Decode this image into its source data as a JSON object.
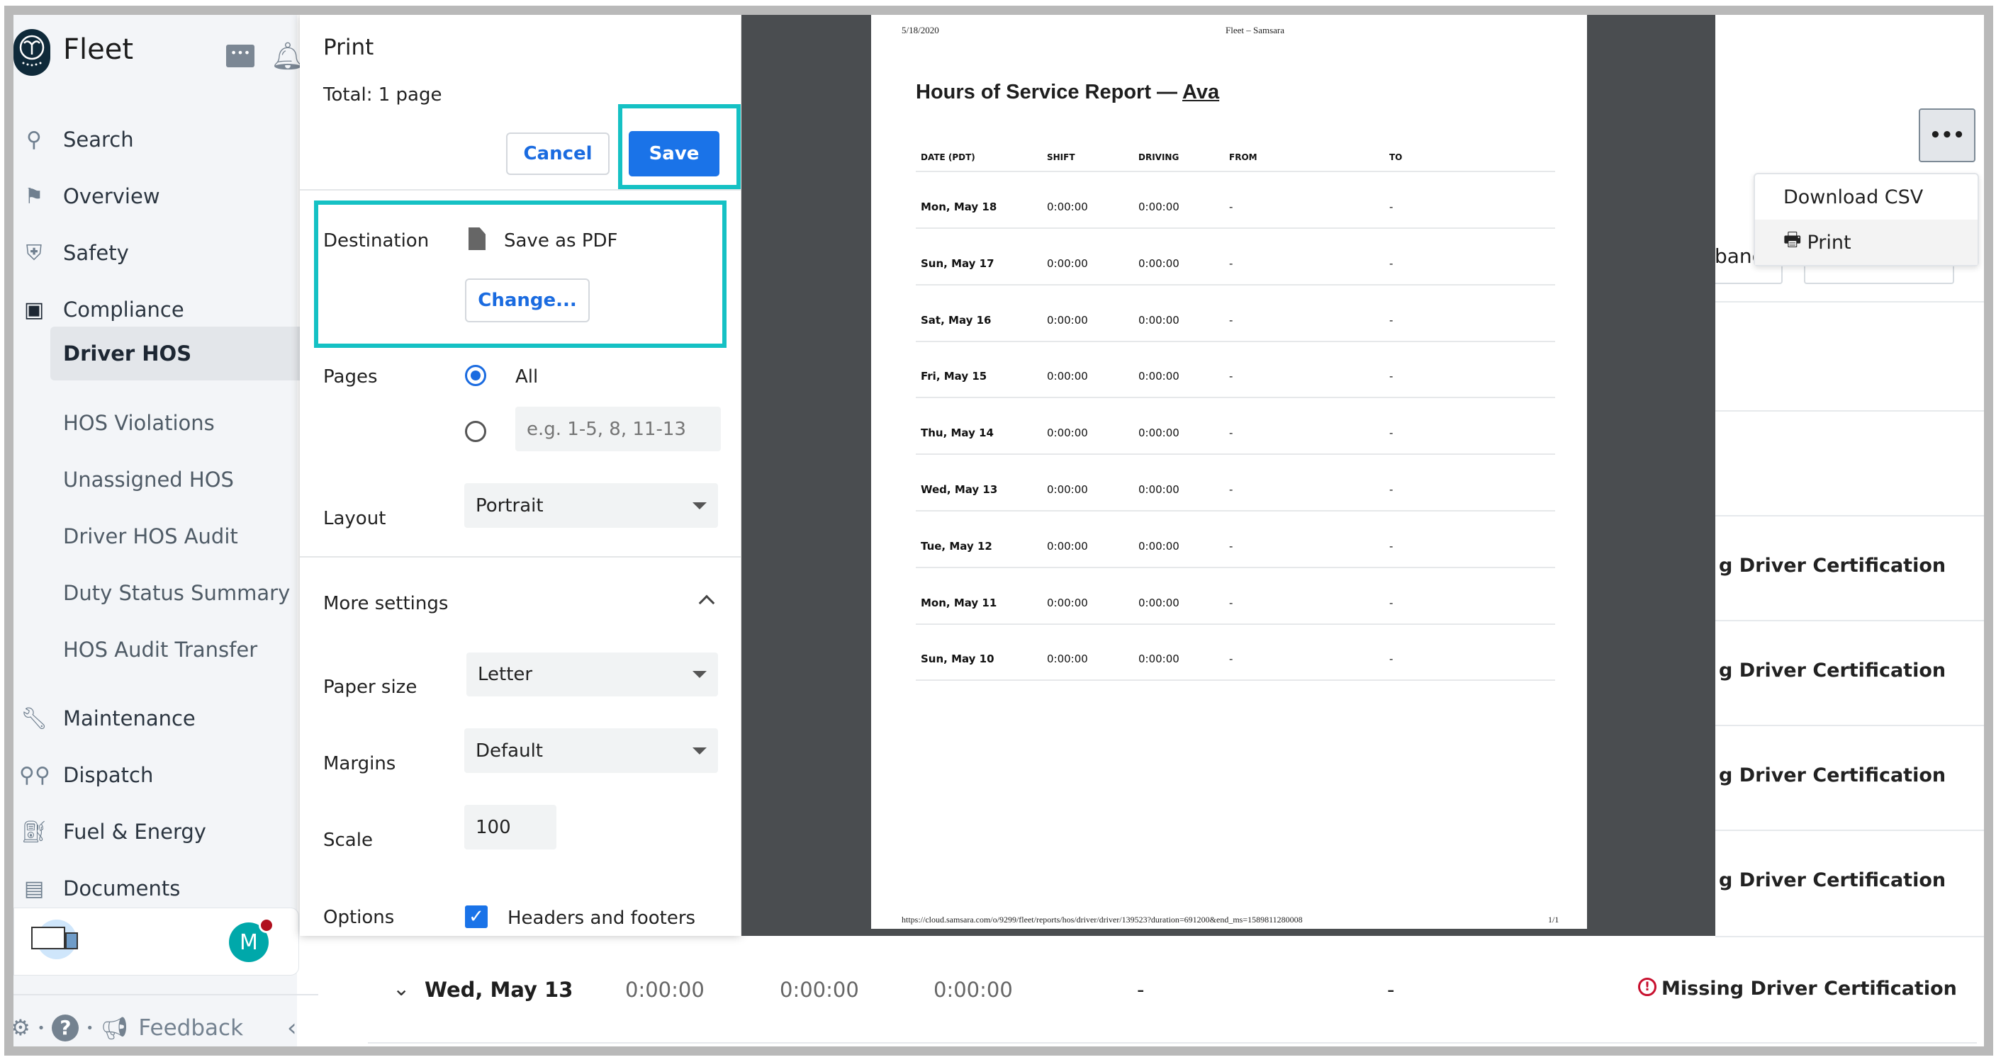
{
  "app": {
    "title": "Fleet"
  },
  "sidebar": {
    "items": [
      {
        "label": "Search",
        "icon": "search-icon"
      },
      {
        "label": "Overview",
        "icon": "map-pin-icon"
      },
      {
        "label": "Safety",
        "icon": "shield-icon"
      },
      {
        "label": "Compliance",
        "icon": "clipboard-icon"
      },
      {
        "label": "Driver HOS",
        "active": true
      },
      {
        "label": "HOS Violations"
      },
      {
        "label": "Unassigned HOS"
      },
      {
        "label": "Driver HOS Audit"
      },
      {
        "label": "Duty Status Summary"
      },
      {
        "label": "HOS Audit Transfer"
      },
      {
        "label": "Maintenance",
        "icon": "wrench-icon"
      },
      {
        "label": "Dispatch",
        "icon": "route-icon"
      },
      {
        "label": "Fuel & Energy",
        "icon": "fuel-icon"
      },
      {
        "label": "Documents",
        "icon": "document-icon"
      }
    ],
    "avatar_initial": "M",
    "feedback": "Feedback"
  },
  "print": {
    "title": "Print",
    "total": "Total: 1 page",
    "cancel": "Cancel",
    "save": "Save",
    "destination_label": "Destination",
    "destination_value": "Save as PDF",
    "change": "Change...",
    "pages_label": "Pages",
    "pages_all": "All",
    "pages_placeholder": "e.g. 1-5, 8, 11-13",
    "layout_label": "Layout",
    "layout_value": "Portrait",
    "more_settings": "More settings",
    "paper_label": "Paper size",
    "paper_value": "Letter",
    "margins_label": "Margins",
    "margins_value": "Default",
    "scale_label": "Scale",
    "scale_value": "100",
    "options_label": "Options",
    "headers_footers": "Headers and footers",
    "headers_footers_checked": true,
    "highlight_color": "#15c1c4"
  },
  "preview": {
    "header_date": "5/18/2020",
    "header_title": "Fleet – Samsara",
    "title": "Hours of Service Report — ",
    "driver": "Ava",
    "columns": [
      "DATE (PDT)",
      "SHIFT",
      "DRIVING",
      "FROM",
      "TO"
    ],
    "rows": [
      [
        "Mon, May 18",
        "0:00:00",
        "0:00:00",
        "-",
        "-"
      ],
      [
        "Sun, May 17",
        "0:00:00",
        "0:00:00",
        "-",
        "-"
      ],
      [
        "Sat, May 16",
        "0:00:00",
        "0:00:00",
        "-",
        "-"
      ],
      [
        "Fri, May 15",
        "0:00:00",
        "0:00:00",
        "-",
        "-"
      ],
      [
        "Thu, May 14",
        "0:00:00",
        "0:00:00",
        "-",
        "-"
      ],
      [
        "Wed, May 13",
        "0:00:00",
        "0:00:00",
        "-",
        "-"
      ],
      [
        "Tue, May 12",
        "0:00:00",
        "0:00:00",
        "-",
        "-"
      ],
      [
        "Mon, May 11",
        "0:00:00",
        "0:00:00",
        "-",
        "-"
      ],
      [
        "Sun, May 10",
        "0:00:00",
        "0:00:00",
        "-",
        "-"
      ]
    ],
    "footer_url": "https://cloud.samsara.com/o/9299/fleet/reports/hos/driver/driver/139523?duration=691200&end_ms=1589811280008",
    "footer_page": "1/1"
  },
  "main": {
    "menu": {
      "items": [
        "Download CSV",
        "Print"
      ]
    },
    "partial_button": "band",
    "cert_partial": "g Driver Certification",
    "row": {
      "date": "Wed, May 13",
      "shift": "0:00:00",
      "driving": "0:00:00",
      "other": "0:00:00",
      "from": "-",
      "to": "-",
      "status": "Missing Driver Certification"
    }
  }
}
